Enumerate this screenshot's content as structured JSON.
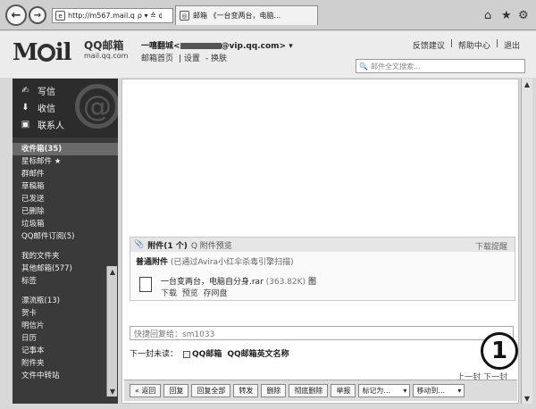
{
  "browser": {
    "address": "http://m567.mail.q",
    "address_controls": "ρ ▾ ≙ ¢",
    "tab_title": "邮箱 《一台变两台，电脑...",
    "icons": [
      "back-arrow-icon",
      "forward-arrow-icon",
      "home-icon",
      "star-icon",
      "gear-icon"
    ]
  },
  "header": {
    "logo_text_m": "M",
    "logo_text_il": "il",
    "logo_title": "QQ邮箱",
    "logo_domain": "mail.qq.com",
    "user_name": "一嘻翻城<",
    "user_email_suffix": "@vip.qq.com>",
    "user_chevron": "▾",
    "user_links": [
      "邮箱首页",
      "设置",
      "换肤"
    ],
    "top_links": [
      "反馈建议",
      "帮助中心",
      "退出"
    ],
    "search_placeholder": "邮件全文搜索..."
  },
  "sidebar": {
    "top_items": [
      {
        "icon": "✍",
        "label": "写信"
      },
      {
        "icon": "⬇",
        "label": "收信"
      },
      {
        "icon": "▣",
        "label": "联系人"
      }
    ],
    "folders_a": [
      "收件箱(35)",
      "星标邮件 ★",
      "群邮件",
      "草稿箱",
      "已发送",
      "已删除",
      "垃圾箱",
      "QQ邮件订阅(5)"
    ],
    "folders_b": [
      "我的文件夹",
      "其他邮箱(577)",
      "标签"
    ],
    "folders_c": [
      "漂流瓶(13)",
      "贺卡",
      "明信片",
      "日历",
      "记事本",
      "附件夹",
      "文件中转站"
    ]
  },
  "attachment": {
    "title": "附件(1 个)",
    "preview_all": "Q 附件预览",
    "download_all": "下载提醒",
    "normal_label": "普通附件",
    "scan_note": "(已通过Avira小红伞杀毒引擎扫描)",
    "file_name": "一台变两台，电脑自分身.rar",
    "file_size": "(363.82K)",
    "file_tag": "图",
    "file_actions": [
      "下载",
      "预览",
      "存网盘"
    ]
  },
  "reply": {
    "placeholder": "快捷回复给：sm1033"
  },
  "next_mail": {
    "label": "下一封未读：",
    "link": "QQ邮箱",
    "subject": "QQ邮箱英文名称"
  },
  "pager": "上一封 下一封",
  "toolbar": {
    "buttons": [
      "« 返回",
      "回复",
      "回复全部",
      "转发",
      "删除",
      "彻底删除",
      "举报"
    ],
    "mark_select": "标记为...",
    "move_select": "移动到..."
  },
  "badge": "1"
}
